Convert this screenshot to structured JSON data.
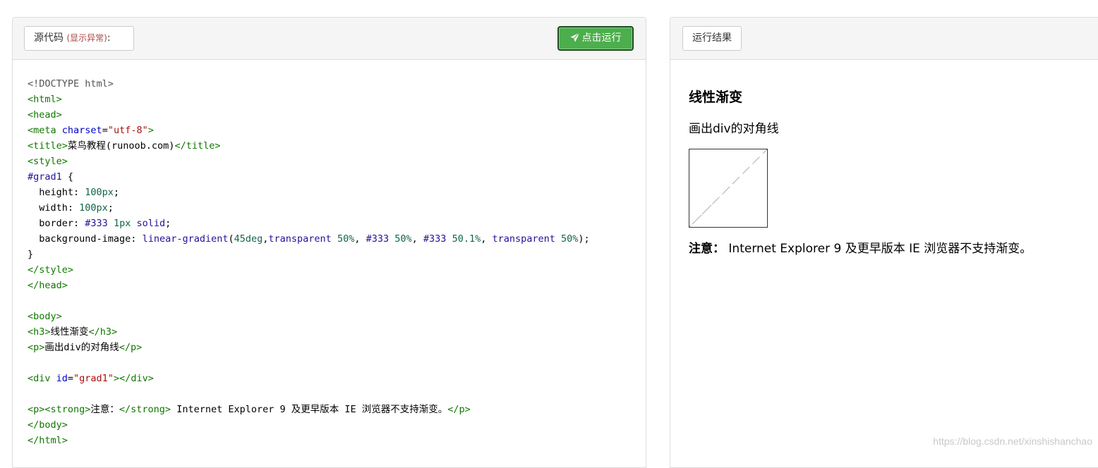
{
  "left_panel": {
    "source_label": "源代码",
    "source_warning": "(显示异常)",
    "source_suffix": ":",
    "run_button": "点击运行",
    "code_lines": [
      [
        {
          "c": "c-doc",
          "t": "<!DOCTYPE html>"
        }
      ],
      [
        {
          "c": "c-tag",
          "t": "<html>"
        }
      ],
      [
        {
          "c": "c-tag",
          "t": "<head>"
        }
      ],
      [
        {
          "c": "c-tag",
          "t": "<meta "
        },
        {
          "c": "c-attr",
          "t": "charset"
        },
        {
          "c": "c-txt",
          "t": "="
        },
        {
          "c": "c-str",
          "t": "\"utf-8\""
        },
        {
          "c": "c-tag",
          "t": ">"
        }
      ],
      [
        {
          "c": "c-tag",
          "t": "<title>"
        },
        {
          "c": "c-txt",
          "t": "菜鸟教程(runoob.com)"
        },
        {
          "c": "c-tag",
          "t": "</title>"
        }
      ],
      [
        {
          "c": "c-tag",
          "t": "<style>"
        }
      ],
      [
        {
          "c": "c-sel",
          "t": "#grad1"
        },
        {
          "c": "c-txt",
          "t": " {"
        }
      ],
      [
        {
          "c": "c-prop",
          "t": "  height: "
        },
        {
          "c": "c-num",
          "t": "100px"
        },
        {
          "c": "c-txt",
          "t": ";"
        }
      ],
      [
        {
          "c": "c-prop",
          "t": "  width: "
        },
        {
          "c": "c-num",
          "t": "100px"
        },
        {
          "c": "c-txt",
          "t": ";"
        }
      ],
      [
        {
          "c": "c-prop",
          "t": "  border: "
        },
        {
          "c": "c-kw",
          "t": "#333"
        },
        {
          "c": "c-txt",
          "t": " "
        },
        {
          "c": "c-num",
          "t": "1px"
        },
        {
          "c": "c-txt",
          "t": " "
        },
        {
          "c": "c-kw",
          "t": "solid"
        },
        {
          "c": "c-txt",
          "t": ";"
        }
      ],
      [
        {
          "c": "c-prop",
          "t": "  background-image: "
        },
        {
          "c": "c-kw",
          "t": "linear-gradient"
        },
        {
          "c": "c-txt",
          "t": "("
        },
        {
          "c": "c-num",
          "t": "45deg"
        },
        {
          "c": "c-txt",
          "t": ","
        },
        {
          "c": "c-kw",
          "t": "transparent"
        },
        {
          "c": "c-txt",
          "t": " "
        },
        {
          "c": "c-num",
          "t": "50%"
        },
        {
          "c": "c-txt",
          "t": ", "
        },
        {
          "c": "c-kw",
          "t": "#333"
        },
        {
          "c": "c-txt",
          "t": " "
        },
        {
          "c": "c-num",
          "t": "50%"
        },
        {
          "c": "c-txt",
          "t": ", "
        },
        {
          "c": "c-kw",
          "t": "#333"
        },
        {
          "c": "c-txt",
          "t": " "
        },
        {
          "c": "c-num",
          "t": "50.1%"
        },
        {
          "c": "c-txt",
          "t": ", "
        },
        {
          "c": "c-kw",
          "t": "transparent"
        },
        {
          "c": "c-txt",
          "t": " "
        },
        {
          "c": "c-num",
          "t": "50%"
        },
        {
          "c": "c-txt",
          "t": ");"
        }
      ],
      [
        {
          "c": "c-txt",
          "t": "}"
        }
      ],
      [
        {
          "c": "c-tag",
          "t": "</style>"
        }
      ],
      [
        {
          "c": "c-tag",
          "t": "</head>"
        }
      ],
      [],
      [
        {
          "c": "c-tag",
          "t": "<body>"
        }
      ],
      [
        {
          "c": "c-tag",
          "t": "<h3>"
        },
        {
          "c": "c-txt",
          "t": "线性渐变"
        },
        {
          "c": "c-tag",
          "t": "</h3>"
        }
      ],
      [
        {
          "c": "c-tag",
          "t": "<p>"
        },
        {
          "c": "c-txt",
          "t": "画出div的对角线"
        },
        {
          "c": "c-tag",
          "t": "</p>"
        }
      ],
      [],
      [
        {
          "c": "c-tag",
          "t": "<div "
        },
        {
          "c": "c-attr",
          "t": "id"
        },
        {
          "c": "c-txt",
          "t": "="
        },
        {
          "c": "c-str",
          "t": "\"grad1\""
        },
        {
          "c": "c-tag",
          "t": "></div>"
        }
      ],
      [],
      [
        {
          "c": "c-tag",
          "t": "<p><strong>"
        },
        {
          "c": "c-txt",
          "t": "注意："
        },
        {
          "c": "c-tag",
          "t": "</strong>"
        },
        {
          "c": "c-txt",
          "t": " Internet Explorer 9 及更早版本 IE 浏览器不支持渐变。"
        },
        {
          "c": "c-tag",
          "t": "</p>"
        }
      ],
      [
        {
          "c": "c-tag",
          "t": "</body>"
        }
      ],
      [
        {
          "c": "c-tag",
          "t": "</html>"
        }
      ]
    ]
  },
  "right_panel": {
    "result_label": "运行结果",
    "heading": "线性渐变",
    "paragraph": "画出div的对角线",
    "note_strong": "注意：",
    "note_text": " Internet Explorer 9 及更早版本 IE 浏览器不支持渐变。"
  },
  "watermark": "https://blog.csdn.net/xinshishanchao",
  "colors": {
    "run_button_bg": "#4cae4c",
    "warning": "#a94442",
    "code_tag": "#117700",
    "code_attr": "#0000cc",
    "code_string": "#aa1111"
  },
  "icons": {
    "run": "paper-plane-icon"
  }
}
